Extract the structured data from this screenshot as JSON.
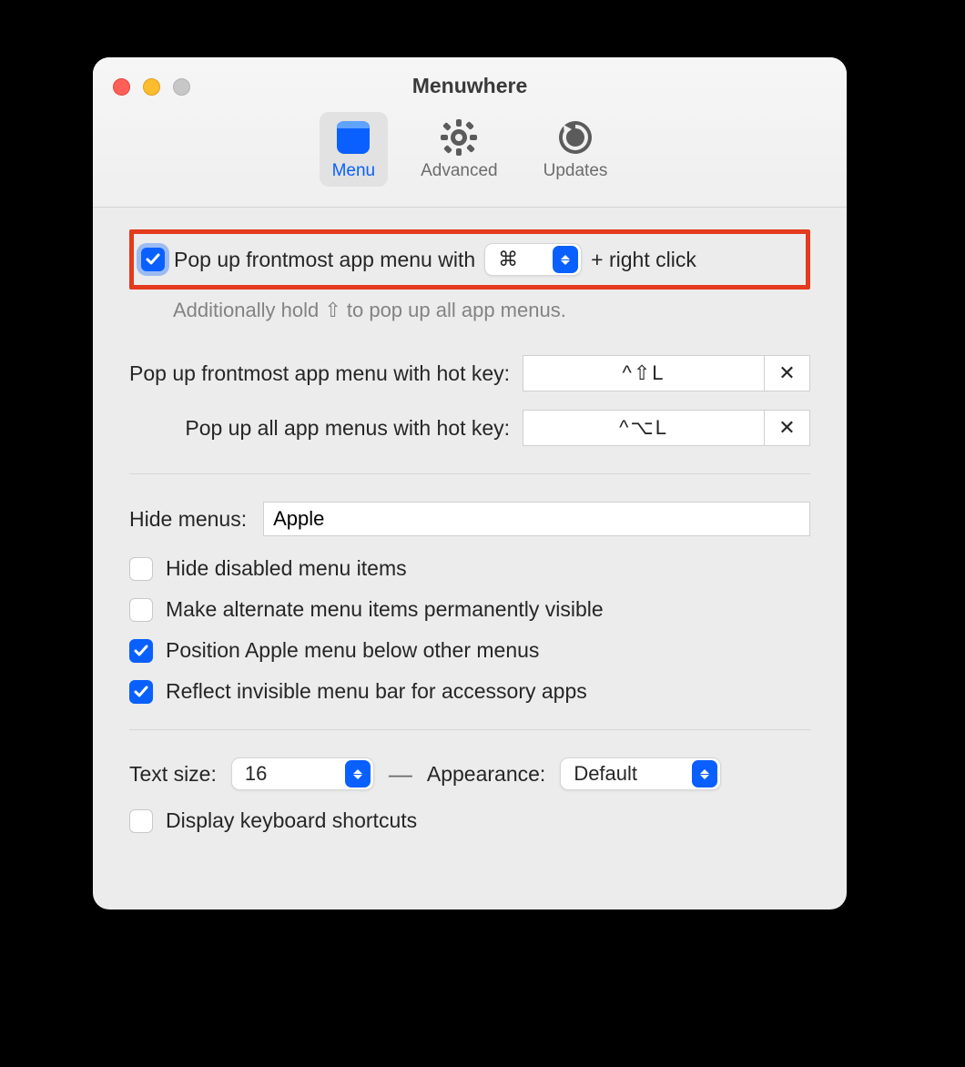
{
  "window": {
    "title": "Menuwhere"
  },
  "toolbar": {
    "tabs": [
      {
        "label": "Menu",
        "selected": true
      },
      {
        "label": "Advanced",
        "selected": false
      },
      {
        "label": "Updates",
        "selected": false
      }
    ]
  },
  "main": {
    "popup_checkbox_label": "Pop up frontmost app menu with",
    "popup_modifier": "⌘",
    "popup_suffix": "+ right click",
    "hint": "Additionally hold ⇧ to pop up all app menus.",
    "hotkeys": {
      "frontmost_label": "Pop up frontmost app menu with hot key:",
      "frontmost_value": "^⇧L",
      "all_label": "Pop up all app menus with hot key:",
      "all_value": "^⌥L",
      "clear_symbol": "✕"
    },
    "hide_menus_label": "Hide menus:",
    "hide_menus_value": "Apple",
    "options": {
      "hide_disabled": {
        "label": "Hide disabled menu items",
        "checked": false
      },
      "alternate_visible": {
        "label": "Make alternate menu items permanently visible",
        "checked": false
      },
      "position_apple": {
        "label": "Position Apple menu below other menus",
        "checked": true
      },
      "reflect_invisible": {
        "label": "Reflect invisible menu bar for accessory apps",
        "checked": true
      }
    },
    "text_size_label": "Text size:",
    "text_size_value": "16",
    "appearance_label": "Appearance:",
    "appearance_value": "Default",
    "display_shortcuts": {
      "label": "Display keyboard shortcuts",
      "checked": false
    }
  }
}
